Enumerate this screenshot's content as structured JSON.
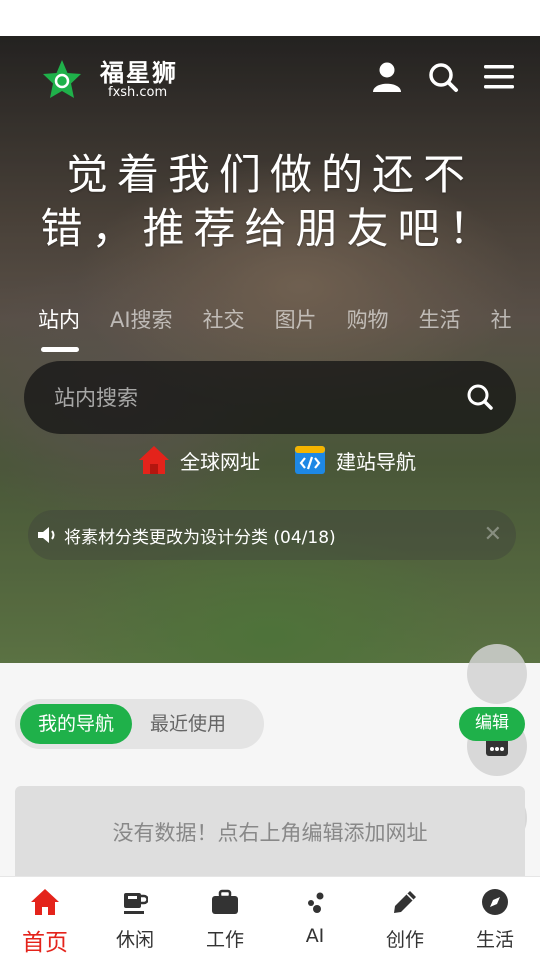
{
  "logo": {
    "cn": "福星狮",
    "en": "fxsh.com"
  },
  "slogan": {
    "line1": "觉着我们做的还不",
    "line2": "错，推荐给朋友吧！"
  },
  "search_tabs": [
    "站内",
    "AI搜索",
    "社交",
    "图片",
    "购物",
    "生活",
    "社"
  ],
  "search": {
    "placeholder": "站内搜索"
  },
  "quick_links": [
    {
      "label": "全球网址",
      "icon": "house-icon"
    },
    {
      "label": "建站导航",
      "icon": "code-window-icon"
    }
  ],
  "notice": {
    "text": "将素材分类更改为设计分类 (04/18)"
  },
  "nav_toggle": {
    "mine": "我的导航",
    "recent": "最近使用"
  },
  "edit_label": "编辑",
  "empty_text": "没有数据！点右上角编辑添加网址",
  "bottom_nav": [
    {
      "label": "首页",
      "icon": "home-icon",
      "active": true
    },
    {
      "label": "休闲",
      "icon": "coffee-icon"
    },
    {
      "label": "工作",
      "icon": "briefcase-icon"
    },
    {
      "label": "AI",
      "icon": "ai-dots-icon"
    },
    {
      "label": "创作",
      "icon": "pencil-icon"
    },
    {
      "label": "生活",
      "icon": "compass-icon"
    }
  ],
  "colors": {
    "brand_green": "#1fb14a",
    "active_red": "#e4231b"
  }
}
